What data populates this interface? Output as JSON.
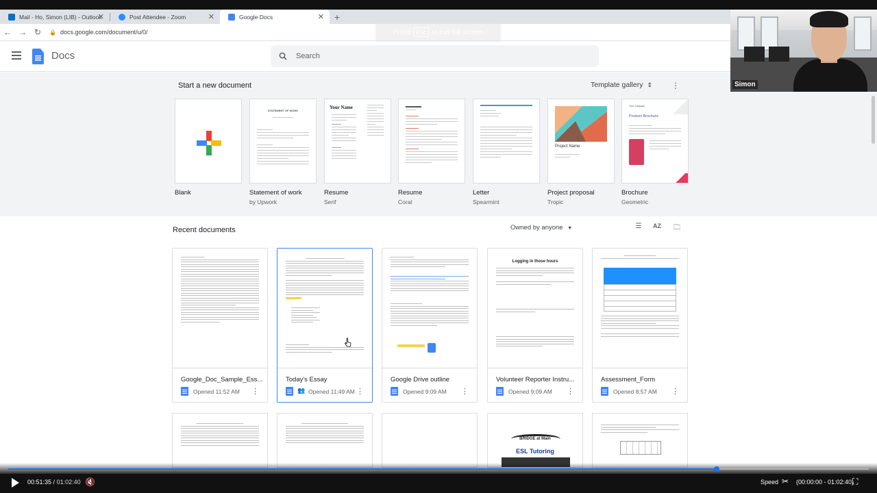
{
  "browser": {
    "tabs": [
      {
        "title": "Mail - Ho, Simon (LIB) - Outlook",
        "icon": "outlook-icon",
        "color": "#0072c6"
      },
      {
        "title": "Post Attendee - Zoom",
        "icon": "zoom-icon",
        "color": "#2d8cff"
      },
      {
        "title": "Google Docs",
        "icon": "docs-icon",
        "color": "#4285f4"
      }
    ],
    "close_glyph": "✕",
    "new_tab_glyph": "+",
    "url": "docs.google.com/document/u/0/",
    "fullscreen_hint": {
      "pre": "Press",
      "key": "Esc",
      "post": "to exit full screen"
    }
  },
  "docs": {
    "app_name": "Docs",
    "search_placeholder": "Search"
  },
  "templates": {
    "heading": "Start a new document",
    "gallery_label": "Template gallery",
    "items": [
      {
        "name": "Blank",
        "sub": ""
      },
      {
        "name": "Statement of work",
        "sub": "by Upwork"
      },
      {
        "name": "Resume",
        "sub": "Serif"
      },
      {
        "name": "Resume",
        "sub": "Coral"
      },
      {
        "name": "Letter",
        "sub": "Spearmint"
      },
      {
        "name": "Project proposal",
        "sub": "Tropic"
      },
      {
        "name": "Brochure",
        "sub": "Geometric"
      }
    ],
    "thumb_text": {
      "statement": "STATEMENT OF WORK",
      "resume_name": "Your Name",
      "project_name": "Project Name",
      "brochure_company": "Your Company",
      "brochure_title": "Product Brochure"
    }
  },
  "recent": {
    "heading": "Recent documents",
    "owner_filter": "Owned by anyone",
    "docs": [
      {
        "title": "Google_Doc_Sample_Ess...",
        "opened": "Opened 11:52 AM",
        "shared": false
      },
      {
        "title": "Today's Essay",
        "opened": "Opened 11:49 AM",
        "shared": true
      },
      {
        "title": "Google Drive outline",
        "opened": "Opened 9:09 AM",
        "shared": false
      },
      {
        "title": "Volunteer Reporter Instru...",
        "opened": "Opened 9:09 AM",
        "shared": false
      },
      {
        "title": "Assessment_Form",
        "opened": "Opened 8:57 AM",
        "shared": false
      }
    ],
    "preview_text": {
      "logging_title": "Logging in those hours",
      "bridge_text": "BRIDGE at Main",
      "esl_text": "ESL Tutoring"
    }
  },
  "webcam": {
    "name": "Simon"
  },
  "player": {
    "current": "00:51:35",
    "separator": " / ",
    "duration": "01:02:40",
    "progress": 0.823,
    "speed_label": "Speed",
    "range": "(00:00:00 - 01:02:40)"
  }
}
